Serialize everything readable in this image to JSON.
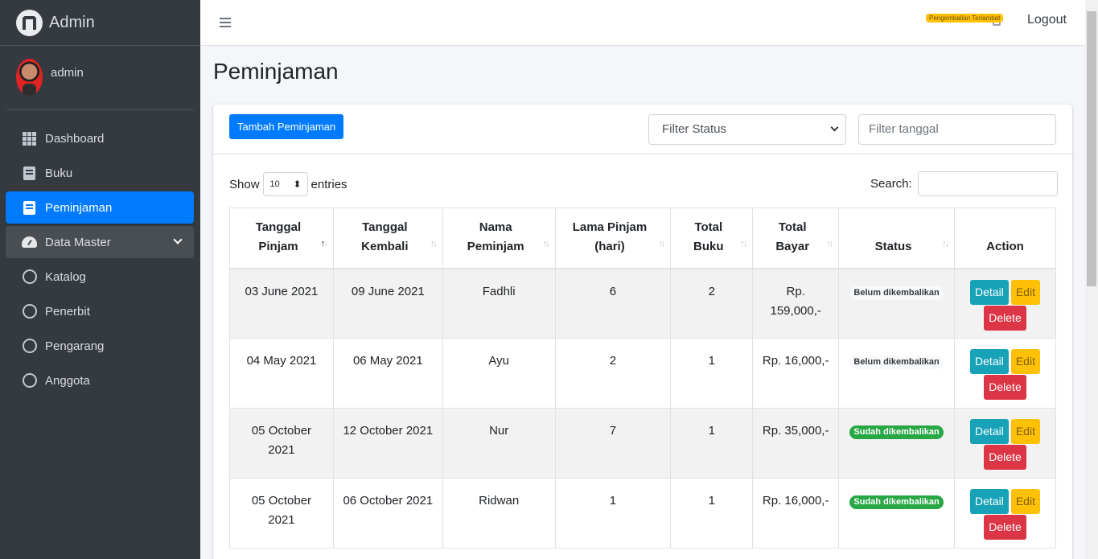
{
  "brand": {
    "name": "Admin"
  },
  "user": {
    "name": "admin"
  },
  "sidebar": {
    "items": [
      {
        "label": "Dashboard",
        "icon": "grid-icon"
      },
      {
        "label": "Buku",
        "icon": "book-icon"
      },
      {
        "label": "Peminjaman",
        "icon": "book-icon",
        "active": true
      },
      {
        "label": "Data Master",
        "icon": "gauge-icon",
        "open": true
      },
      {
        "label": "Katalog",
        "icon": "circle-icon"
      },
      {
        "label": "Penerbit",
        "icon": "circle-icon"
      },
      {
        "label": "Pengarang",
        "icon": "circle-icon"
      },
      {
        "label": "Anggota",
        "icon": "circle-icon"
      }
    ]
  },
  "topbar": {
    "notification": "Pengembalian Terlambat",
    "logout": "Logout"
  },
  "page": {
    "title": "Peminjaman"
  },
  "toolbar": {
    "add_button": "Tambah Peminjaman",
    "filter_status": "Filter Status",
    "filter_date_placeholder": "Filter tanggal"
  },
  "datatable": {
    "show_label": "Show",
    "entries_value": "10",
    "entries_label": "entries",
    "search_label": "Search:"
  },
  "table": {
    "headers": [
      [
        "Tanggal",
        "Pinjam"
      ],
      [
        "Tanggal",
        "Kembali"
      ],
      [
        "Nama",
        "Peminjam"
      ],
      [
        "Lama Pinjam",
        "(hari)"
      ],
      [
        "Total",
        "Buku"
      ],
      [
        "Total",
        "Bayar"
      ],
      [
        "Status",
        ""
      ],
      [
        "Action",
        ""
      ]
    ],
    "rows": [
      {
        "tgl_pinjam": "03 June 2021",
        "tgl_kembali": "09 June 2021",
        "nama": "Fadhli",
        "lama": "6",
        "buku": "2",
        "bayar": "Rp. 159,000,-",
        "status": "Belum dikembalikan"
      },
      {
        "tgl_pinjam": "04 May 2021",
        "tgl_kembali": "06 May 2021",
        "nama": "Ayu",
        "lama": "2",
        "buku": "1",
        "bayar": "Rp. 16,000,-",
        "status": "Belum dikembalikan"
      },
      {
        "tgl_pinjam": "05 October 2021",
        "tgl_kembali": "12 October 2021",
        "nama": "Nur",
        "lama": "7",
        "buku": "1",
        "bayar": "Rp. 35,000,-",
        "status": "Sudah dikembalikan"
      },
      {
        "tgl_pinjam": "05 October 2021",
        "tgl_kembali": "06 October 2021",
        "nama": "Ridwan",
        "lama": "1",
        "buku": "1",
        "bayar": "Rp. 16,000,-",
        "status": "Sudah dikembalikan"
      }
    ],
    "action_labels": {
      "detail": "Detail",
      "edit": "Edit",
      "delete": "Delete"
    }
  },
  "colors": {
    "primary": "#007bff",
    "sidebar_bg": "#343a40",
    "success": "#28a745",
    "warning": "#ffc107",
    "danger": "#dc3545",
    "info": "#17a2b8"
  }
}
